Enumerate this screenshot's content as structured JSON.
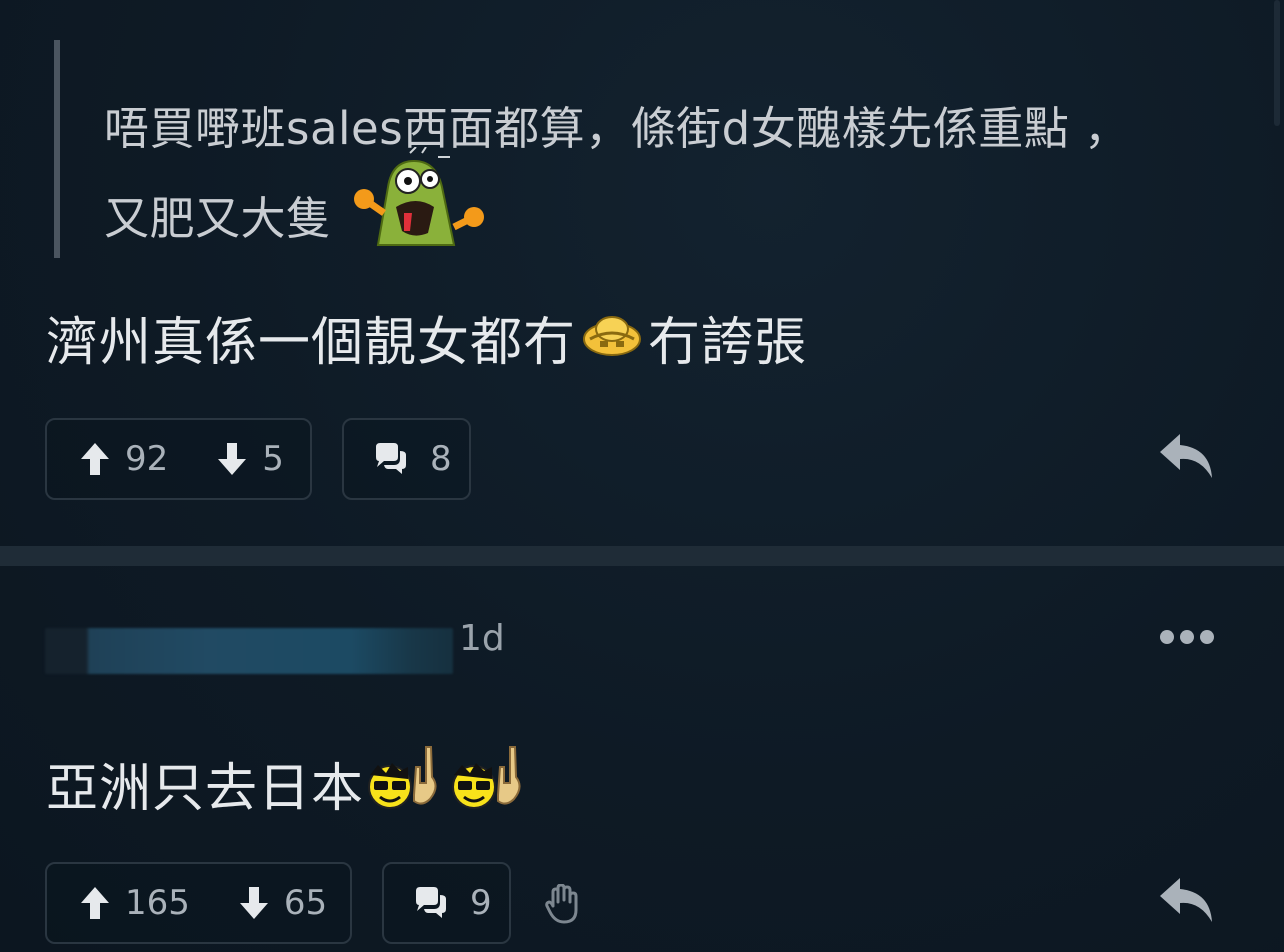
{
  "posts": [
    {
      "quote": {
        "line1": "唔買嘢班sales西面都算，條街d女醜樣先係重點 ，",
        "line2": "又肥又大隻"
      },
      "body": {
        "text_before": "濟州真係一個靚女都冇",
        "text_after": "冇誇張"
      },
      "emojis": [
        "shocked-green-monster-emoji",
        "embarrassed-face-emoji"
      ],
      "upvotes": "92",
      "downvotes": "5",
      "comments": "8"
    },
    {
      "author": "",
      "timestamp": "1d",
      "body": {
        "text": "亞洲只去日本"
      },
      "emojis": [
        "sunglasses-rock-emoji",
        "sunglasses-rock-emoji"
      ],
      "upvotes": "165",
      "downvotes": "65",
      "comments": "9"
    }
  ],
  "icons": {
    "upvote": "arrow-up-icon",
    "downvote": "arrow-down-icon",
    "comments": "speech-bubbles-icon",
    "reply": "reply-arrow-icon",
    "more": "more-dots-icon",
    "hand": "raised-hand-icon"
  },
  "colors": {
    "background": "#0f1b26",
    "text": "#e6e9ec",
    "muted": "#aab2ba",
    "divider": "#1f2c37"
  }
}
